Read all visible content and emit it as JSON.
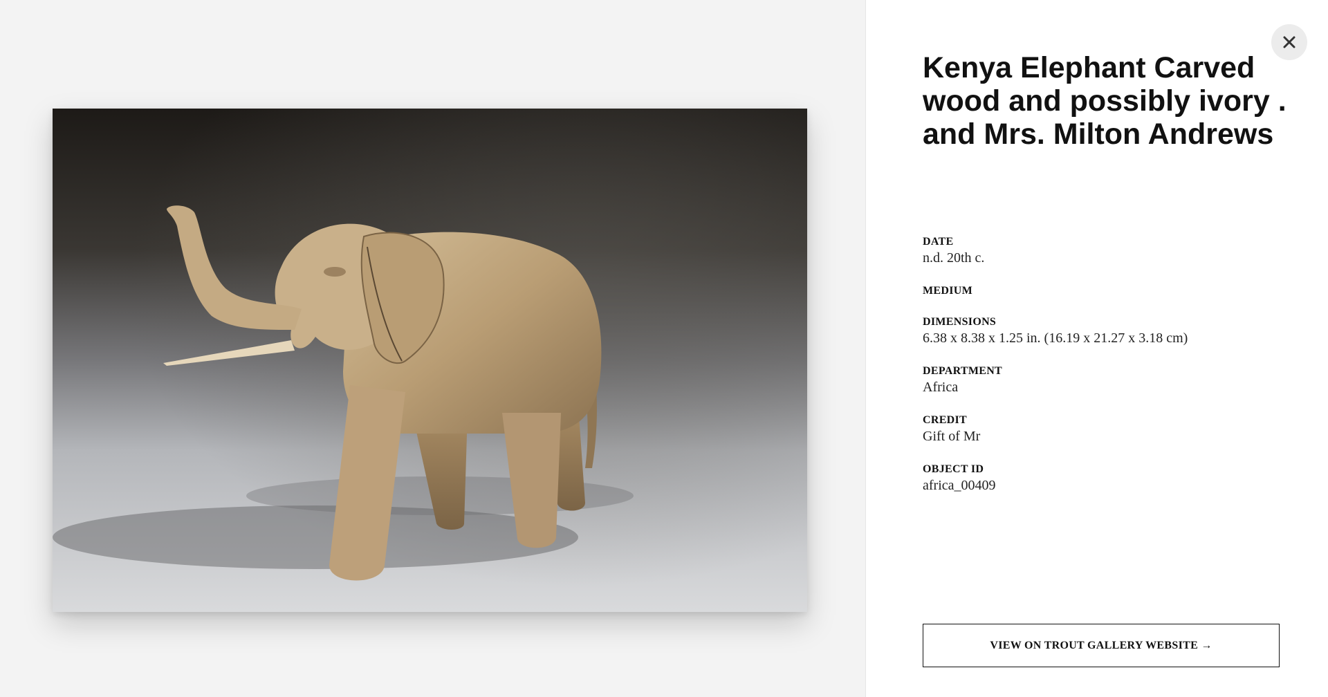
{
  "artwork": {
    "title": "Kenya Elephant Carved wood and possibly ivory . and Mrs. Milton Andrews",
    "image_alt": "carved wooden elephant"
  },
  "close": {
    "label": "✕"
  },
  "fields": [
    {
      "label": "DATE",
      "value": "n.d. 20th c."
    },
    {
      "label": "MEDIUM",
      "value": ""
    },
    {
      "label": "DIMENSIONS",
      "value": "6.38 x 8.38 x 1.25 in. (16.19 x 21.27 x 3.18 cm)"
    },
    {
      "label": "DEPARTMENT",
      "value": "Africa"
    },
    {
      "label": "CREDIT",
      "value": "Gift of Mr"
    },
    {
      "label": "OBJECT ID",
      "value": "africa_00409"
    }
  ],
  "website_button": {
    "label": "VIEW ON TROUT GALLERY WEBSITE →"
  }
}
